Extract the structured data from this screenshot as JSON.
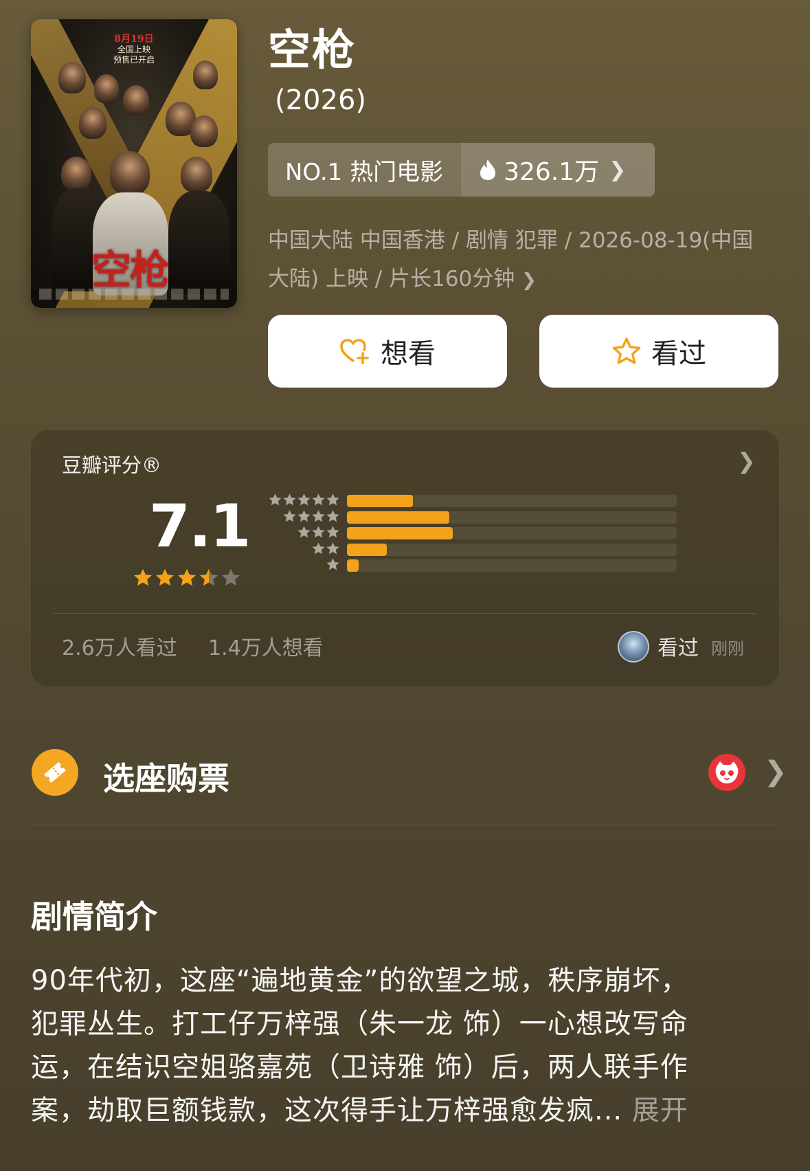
{
  "movie": {
    "title": "空枪",
    "year": "(2026)",
    "rank_label": "NO.1 热门电影",
    "heat": "326.1万",
    "meta_line1": "中国大陆 中国香港 / 剧情 犯罪 / 2026-08-19(中国",
    "meta_line2": "大陆) 上映 / 片长160分钟",
    "poster": {
      "date_line1": "8月19日",
      "date_line2": "全国上映",
      "date_line3": "预售已开启",
      "title": "空枪"
    }
  },
  "actions": {
    "want_label": "想看",
    "seen_label": "看过"
  },
  "rating": {
    "label": "豆瓣评分®",
    "score": "7.1",
    "score_stars": 3.5,
    "distribution": [
      {
        "stars": 5,
        "value": 0.2
      },
      {
        "stars": 4,
        "value": 0.31
      },
      {
        "stars": 3,
        "value": 0.32
      },
      {
        "stars": 2,
        "value": 0.12
      },
      {
        "stars": 1,
        "value": 0.035
      }
    ],
    "watched_count": "2.6万人看过",
    "wish_count": "1.4万人想看",
    "friend_status": "看过",
    "friend_time": "刚刚"
  },
  "tickets": {
    "label": "选座购票"
  },
  "synopsis": {
    "heading": "剧情简介",
    "line1": "90年代初，这座“遍地黄金”的欲望之城，秩序崩坏，",
    "line2": "犯罪丛生。打工仔万梓强（朱一龙 饰）一心想改写命",
    "line3": "运，在结识空姐骆嘉苑（卫诗雅 饰）后，两人联手作",
    "line4": "案，劫取巨额钱款，这次得手让万梓强愈发疯...",
    "expand": "展开"
  },
  "colors": {
    "accent_orange": "#f5a21b",
    "maoyan_red": "#e8343a"
  },
  "icons": [
    "heart-plus-icon",
    "star-icon",
    "flame-icon",
    "chevron-right-icon",
    "ticket-icon",
    "maoyan-cat-icon"
  ]
}
